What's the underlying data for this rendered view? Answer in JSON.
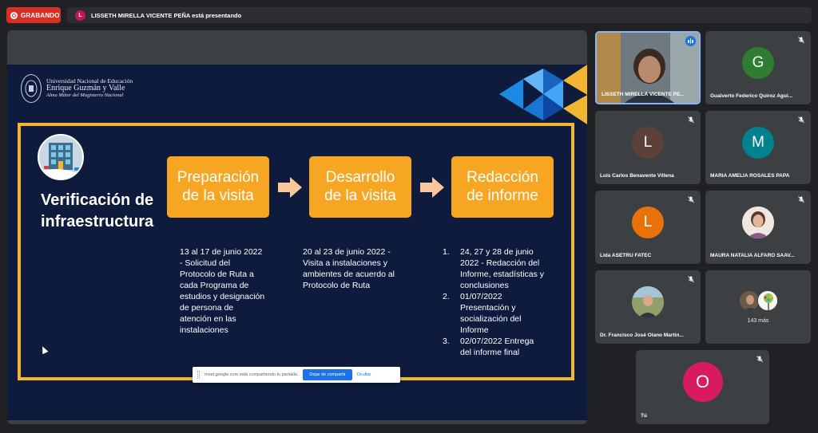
{
  "recording": {
    "label": "GRABANDO"
  },
  "presenting": {
    "avatar_letter": "L",
    "text": "LISSETH MIRELLA VICENTE PEÑA está presentando"
  },
  "slide": {
    "university": {
      "line1": "Universidad Nacional de Educación",
      "line2": "Enrique Guzmán y Valle",
      "line3": "Alma Máter del Magisterio Nacional"
    },
    "section_title_line1": "Verificación de",
    "section_title_line2": "infraestructura",
    "steps": [
      {
        "line1": "Preparación",
        "line2": "de la visita"
      },
      {
        "line1": "Desarrollo",
        "line2": "de la visita"
      },
      {
        "line1": "Redacción",
        "line2": "de informe"
      }
    ],
    "step1_desc": [
      "13 al 17 de junio 2022",
      "- Solicitud del",
      "Protocolo de Ruta a",
      "cada Programa de",
      "estudios y designación",
      "de persona de",
      "atención en las",
      "instalaciones"
    ],
    "step2_desc": [
      "20 al 23 de junio 2022 -",
      "Visita a instalaciones y",
      "ambientes de acuerdo al",
      "Protocolo de Ruta"
    ],
    "step3_items": [
      {
        "num": "1.",
        "lines": [
          "24, 27 y 28 de junio",
          "2022 - Redacción del",
          "Informe, estadísticas y",
          "conclusiones"
        ]
      },
      {
        "num": "2.",
        "lines": [
          "01/07/2022",
          "Presentación y",
          "socialización del",
          "Informe"
        ]
      },
      {
        "num": "3.",
        "lines": [
          "02/07/2022 Entrega",
          "del informe final"
        ]
      }
    ],
    "colors": {
      "background": "#0f1b3d",
      "frame": "#f2b632",
      "step_box": "#f6a623",
      "arrow": "#f9c79a"
    }
  },
  "share_bar": {
    "message": "meet.google.com está compartiendo tu pantalla.",
    "stop_label": "Dejar de compartir",
    "hide_label": "Ocultar"
  },
  "participants": [
    {
      "name": "LISSETH MIRELLA VICENTE PE...",
      "type": "video",
      "speaking": true
    },
    {
      "name": "Gualverto Federico Quiroz Agui...",
      "initial": "G",
      "color": "#2e7d32",
      "muted": true
    },
    {
      "name": "Luis Carlos Benavente Villena",
      "initial": "L",
      "color": "#5d4037",
      "muted": true
    },
    {
      "name": "MARIA AMELIA ROSALES PAPA",
      "initial": "M",
      "color": "#00838f",
      "muted": true
    },
    {
      "name": "Lida ASETRU FATEC",
      "initial": "L",
      "color": "#e8710a",
      "muted": true
    },
    {
      "name": "MAURA NATALIA ALFARO SAAV...",
      "type": "photo",
      "muted": true
    },
    {
      "name": "Dr. Francisco José Olano Martin...",
      "type": "photo",
      "muted": true
    },
    {
      "name": "143 más",
      "type": "more"
    },
    {
      "name": "Tú",
      "initial": "O",
      "color": "#d81b60",
      "muted": true
    }
  ]
}
